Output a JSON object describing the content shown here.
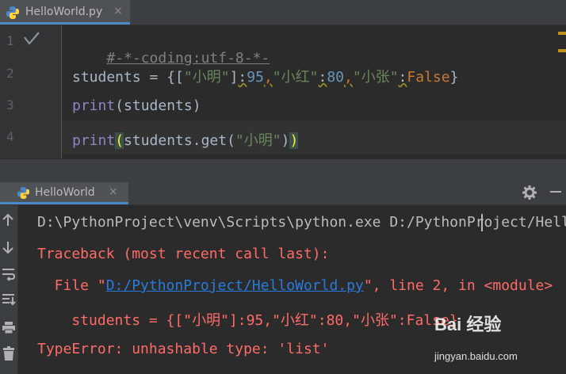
{
  "editor": {
    "tab": {
      "title": "HelloWorld.py",
      "close": "×"
    },
    "line_numbers": [
      "1",
      "2",
      "3",
      "4"
    ],
    "lines": {
      "l1": "#-*-coding:utf-8-*-",
      "l2": {
        "a": "students = {[",
        "b": "\"小明\"",
        "c": "]",
        "d": ":",
        "e": "95",
        "f": ",",
        "g": "\"小红\"",
        "h": ":",
        "i": "80",
        "j": ",",
        "k": "\"小张\"",
        "l": ":",
        "m": "False",
        "n": "}"
      },
      "l3": {
        "a": "print",
        "b": "(students)"
      },
      "l4": {
        "a": "print",
        "b": "(",
        "c": "students.get(",
        "d": "\"小明\"",
        "e": ")",
        "f": ")"
      }
    }
  },
  "run": {
    "tab": {
      "title": "HelloWorld",
      "close": "×"
    },
    "console": {
      "cmd": "D:\\PythonProject\\venv\\Scripts\\python.exe D:/PythonProject/HelloWorld.py",
      "traceback": "Traceback (most recent call last):",
      "file_prefix": "  File \"",
      "file_link": "D:/PythonProject/HelloWorld.py",
      "file_suffix": "\", line 2, in <module>",
      "code_line": "    students = {[\"小明\"]:95,\"小红\":80,\"小张\":False}",
      "error": "TypeError: unhashable type: 'list'"
    }
  },
  "watermark": {
    "logo": "Bai 经验",
    "url": "jingyan.baidu.com"
  },
  "colors": {
    "background": "#2b2b2b",
    "panel": "#3c3f41",
    "accent": "#4a88c7",
    "string": "#6a8759",
    "number": "#6897bb",
    "keyword": "#cc7832",
    "error": "#ff6b68",
    "link": "#287bde"
  }
}
